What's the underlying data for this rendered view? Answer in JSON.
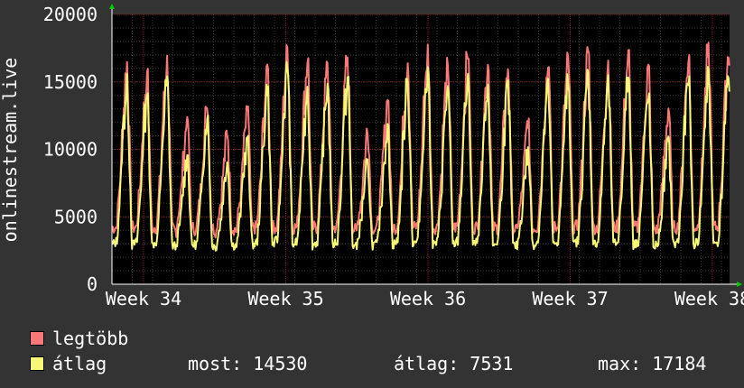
{
  "chart_data": {
    "type": "line",
    "ylabel": "onlinestream.live",
    "ylim": [
      0,
      20000
    ],
    "y_ticks": [
      "0",
      "5000",
      "10000",
      "15000",
      "20000"
    ],
    "x_ticks": [
      "Week 34",
      "Week 35",
      "Week 36",
      "Week 37",
      "Week 38"
    ],
    "grid": true,
    "weeks": 4.4,
    "daily_peaks": {
      "max": [
        17000,
        16500,
        17200,
        12500,
        13800,
        11500,
        13300,
        16500,
        18200,
        17200,
        16800,
        17400,
        11800,
        14000,
        17300,
        18100,
        17000,
        17500,
        17200,
        16600,
        12300,
        17000,
        17200,
        17800,
        17000,
        17600,
        16500,
        13500,
        17300,
        18000,
        17700,
        17000,
        17200
      ],
      "avg": [
        15600,
        14500,
        15700,
        9800,
        12800,
        9300,
        11300,
        14800,
        16700,
        15000,
        15200,
        15800,
        9300,
        12300,
        15500,
        16300,
        15000,
        15800,
        14800,
        15200,
        10300,
        15300,
        15600,
        16000,
        15500,
        15700,
        14500,
        11000,
        15700,
        16200,
        15900,
        15000,
        14530
      ]
    },
    "series": [
      {
        "name": "legtöbb",
        "color": "#f87878"
      },
      {
        "name": "átlag",
        "color": "#f8f878"
      }
    ]
  },
  "legend": {
    "items": [
      {
        "label": "legtöbb",
        "color": "#f87878"
      },
      {
        "label": "átlag",
        "color": "#f8f878"
      }
    ],
    "stats": {
      "now": "most: 14530",
      "avg": "átlag: 7531",
      "max": "max: 17184"
    }
  }
}
